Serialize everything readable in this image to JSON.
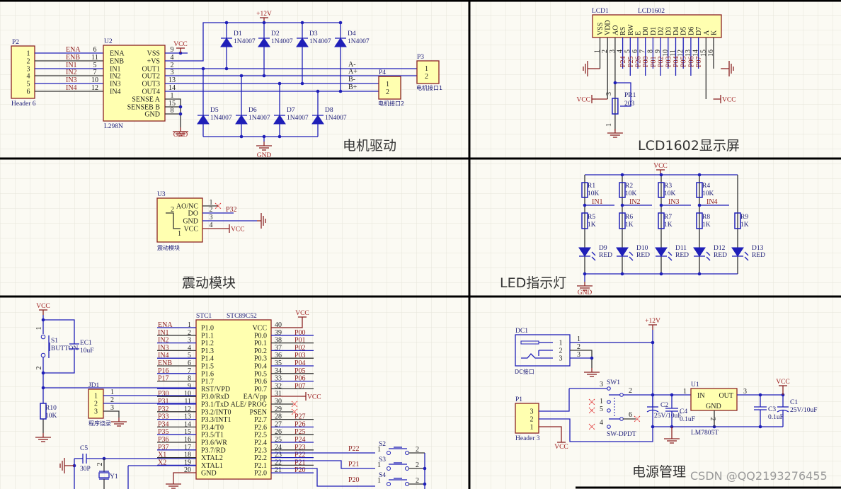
{
  "colors": {
    "wire": "#1f1fb8",
    "body_fill": "#ffffb0",
    "body_border": "#8b2323",
    "net_label": "#8b1c1c",
    "background": "#fbfaf3"
  },
  "sections": {
    "motor": "电机驱动",
    "lcd": "LCD1602显示屏",
    "vibration": "震动模块",
    "led": "LED指示灯",
    "power": "电源管理"
  },
  "watermark": "CSDN @QQ2193276455",
  "motor": {
    "p2": {
      "ref": "P2",
      "name": "Header 6",
      "pins": [
        "1",
        "2",
        "3",
        "4",
        "5",
        "6"
      ]
    },
    "u2": {
      "ref": "U2",
      "name": "L298N",
      "left_pins": [
        {
          "num": "6",
          "label": "ENA",
          "net": "ENA"
        },
        {
          "num": "11",
          "label": "ENB",
          "net": "ENB"
        },
        {
          "num": "5",
          "label": "IN1",
          "net": "IN1"
        },
        {
          "num": "7",
          "label": "IN2",
          "net": "IN2"
        },
        {
          "num": "10",
          "label": "IN3",
          "net": "IN3"
        },
        {
          "num": "12",
          "label": "IN4",
          "net": "IN4"
        }
      ],
      "right_pins": [
        {
          "num": "9",
          "label": "VSS"
        },
        {
          "num": "4",
          "label": "+VS"
        },
        {
          "num": "2",
          "label": "OUT1"
        },
        {
          "num": "3",
          "label": "OUT2"
        },
        {
          "num": "13",
          "label": "OUT3"
        },
        {
          "num": "14",
          "label": "OUT4"
        },
        {
          "num": "1",
          "label": "SENSE A"
        },
        {
          "num": "15",
          "label": "SENSEB B"
        },
        {
          "num": "8",
          "label": "GND"
        }
      ]
    },
    "vcc": "VCC",
    "gnd": "GND",
    "v12": "+12V",
    "gnd2": "GND",
    "diodes": [
      {
        "ref": "D1",
        "value": "1N4007"
      },
      {
        "ref": "D2",
        "value": "1N4007"
      },
      {
        "ref": "D3",
        "value": "1N4007"
      },
      {
        "ref": "D4",
        "value": "1N4007"
      },
      {
        "ref": "D5",
        "value": "1N4007"
      },
      {
        "ref": "D6",
        "value": "1N4007"
      },
      {
        "ref": "D7",
        "value": "1N4007"
      },
      {
        "ref": "D8",
        "value": "1N4007"
      }
    ],
    "outs": [
      "A-",
      "A+",
      "B-",
      "B+"
    ],
    "p3": {
      "ref": "P3",
      "name": "电机接口1",
      "pins": [
        "1",
        "2"
      ]
    },
    "p4": {
      "ref": "P4",
      "name": "电机接口2",
      "pins": [
        "1",
        "2"
      ]
    }
  },
  "lcd": {
    "ref": "LCD1",
    "name": "LCD1602",
    "pins": [
      {
        "num": "1",
        "label": "VSS"
      },
      {
        "num": "2",
        "label": "VDD"
      },
      {
        "num": "3",
        "label": "AO"
      },
      {
        "num": "4",
        "label": "RS"
      },
      {
        "num": "5",
        "label": "RW"
      },
      {
        "num": "6",
        "label": "E"
      },
      {
        "num": "7",
        "label": "D0"
      },
      {
        "num": "8",
        "label": "D1"
      },
      {
        "num": "9",
        "label": "D2"
      },
      {
        "num": "10",
        "label": "D3"
      },
      {
        "num": "11",
        "label": "D4"
      },
      {
        "num": "12",
        "label": "D5"
      },
      {
        "num": "13",
        "label": "D6"
      },
      {
        "num": "14",
        "label": "D7"
      },
      {
        "num": "15",
        "label": "A"
      },
      {
        "num": "16",
        "label": "K"
      }
    ],
    "nets": [
      "P24",
      "P25",
      "P26",
      "P00",
      "P01",
      "P02",
      "P03",
      "P04",
      "P05",
      "P06",
      "P07"
    ],
    "pot": {
      "ref": "PR1",
      "value": "203",
      "pin_top": "3",
      "pin_bottom": "1"
    },
    "vcc_left": "VCC",
    "vcc_right": "VCC"
  },
  "vibration": {
    "ref": "U3",
    "name": "震动模块",
    "pins": [
      {
        "num": "1",
        "label": "AO/NC"
      },
      {
        "num": "2",
        "label": "DO"
      },
      {
        "num": "3",
        "label": "GND"
      },
      {
        "num": "4",
        "label": "VCC"
      }
    ],
    "inner_pins": [
      "2",
      "1"
    ],
    "net": "P32",
    "vcc": "VCC"
  },
  "led": {
    "vcc": "VCC",
    "gnd": "GND",
    "pullups": [
      {
        "ref": "R1",
        "value": "10K",
        "net": "IN1"
      },
      {
        "ref": "R2",
        "value": "10K",
        "net": "IN2"
      },
      {
        "ref": "R3",
        "value": "10K",
        "net": "IN3"
      },
      {
        "ref": "R4",
        "value": "10K",
        "net": "IN4"
      }
    ],
    "resistors": [
      {
        "ref": "R5",
        "value": "1K"
      },
      {
        "ref": "R6",
        "value": "1K"
      },
      {
        "ref": "R7",
        "value": "1K"
      },
      {
        "ref": "R8",
        "value": "1K"
      },
      {
        "ref": "R9",
        "value": "1K"
      }
    ],
    "diodes": [
      {
        "ref": "D9",
        "value": "RED"
      },
      {
        "ref": "D10",
        "value": "RED"
      },
      {
        "ref": "D11",
        "value": "RED"
      },
      {
        "ref": "D12",
        "value": "RED"
      },
      {
        "ref": "D13",
        "value": "RED"
      }
    ]
  },
  "mcu": {
    "ref": "STC1",
    "name": "STC89C52",
    "left_pins": [
      {
        "num": "1",
        "label": "P1.0",
        "net": "ENA"
      },
      {
        "num": "2",
        "label": "P1.1",
        "net": "IN1"
      },
      {
        "num": "3",
        "label": "P1.2",
        "net": "IN2"
      },
      {
        "num": "4",
        "label": "P1.3",
        "net": "IN3"
      },
      {
        "num": "5",
        "label": "P1.4",
        "net": "IN4"
      },
      {
        "num": "6",
        "label": "P1.5",
        "net": "ENB"
      },
      {
        "num": "7",
        "label": "P1.6",
        "net": "P16"
      },
      {
        "num": "8",
        "label": "P1.7",
        "net": "P17"
      },
      {
        "num": "9",
        "label": "RST/VPD",
        "net": ""
      },
      {
        "num": "10",
        "label": "P3.0/RxD",
        "net": "P30"
      },
      {
        "num": "11",
        "label": "P3.1/TxD",
        "net": "P31"
      },
      {
        "num": "12",
        "label": "P3.2/INT0",
        "net": "P32"
      },
      {
        "num": "13",
        "label": "P3.3/INT1",
        "net": "P33"
      },
      {
        "num": "14",
        "label": "P3.4/T0",
        "net": "P34"
      },
      {
        "num": "15",
        "label": "P3.5/T1",
        "net": "P35"
      },
      {
        "num": "16",
        "label": "P3.6/WR",
        "net": "P36"
      },
      {
        "num": "17",
        "label": "P3.7/RD",
        "net": "P37"
      },
      {
        "num": "18",
        "label": "XTAL2",
        "net": "X1"
      },
      {
        "num": "19",
        "label": "XTAL1",
        "net": "X2"
      },
      {
        "num": "20",
        "label": "GND",
        "net": ""
      }
    ],
    "right_pins": [
      {
        "num": "40",
        "label": "VCC",
        "net": ""
      },
      {
        "num": "39",
        "label": "P0.0",
        "net": "P00"
      },
      {
        "num": "38",
        "label": "P0.1",
        "net": "P01"
      },
      {
        "num": "37",
        "label": "P0.2",
        "net": "P02"
      },
      {
        "num": "36",
        "label": "P0.3",
        "net": "P03"
      },
      {
        "num": "35",
        "label": "P0.4",
        "net": "P04"
      },
      {
        "num": "34",
        "label": "P0.5",
        "net": "P05"
      },
      {
        "num": "33",
        "label": "P0.6",
        "net": "P06"
      },
      {
        "num": "32",
        "label": "P0.7",
        "net": "P07"
      },
      {
        "num": "31",
        "label": "EA/Vpp",
        "net": ""
      },
      {
        "num": "30",
        "label": "ALE/ PROG",
        "net": ""
      },
      {
        "num": "29",
        "label": "PSEN",
        "net": ""
      },
      {
        "num": "28",
        "label": "P2.7",
        "net": "P27"
      },
      {
        "num": "27",
        "label": "P2.6",
        "net": "P26"
      },
      {
        "num": "26",
        "label": "P2.5",
        "net": "P25"
      },
      {
        "num": "25",
        "label": "P2.4",
        "net": "P24"
      },
      {
        "num": "24",
        "label": "P2.3",
        "net": "P23"
      },
      {
        "num": "23",
        "label": "P2.2",
        "net": "P22"
      },
      {
        "num": "22",
        "label": "P2.1",
        "net": "P21"
      },
      {
        "num": "21",
        "label": "P2.0",
        "net": "P20"
      }
    ],
    "vcc_top": "VCC",
    "vcc_ea": "VCC",
    "buttons": [
      {
        "ref": "S2",
        "net": "P22",
        "pin1": "1",
        "pin2": "2"
      },
      {
        "ref": "S3",
        "net": "P21",
        "pin1": "1",
        "pin2": "2"
      },
      {
        "ref": "S4",
        "net": "P20",
        "pin1": "1",
        "pin2": "2"
      }
    ],
    "reset": {
      "vcc": "VCC",
      "switch_ref": "S1",
      "switch_value": "BUTTON",
      "pin1": "1",
      "pin2": "2",
      "cap_ref": "EC1",
      "cap_value": "10uF",
      "res_ref": "R10",
      "res_value": "10K"
    },
    "jd1": {
      "ref": "JD1",
      "name": "程序烧录",
      "pins": [
        "1",
        "2",
        "3"
      ],
      "wire_pins": [
        "1",
        "2",
        "3"
      ]
    },
    "crystal": {
      "cap_ref": "C5",
      "cap_value": "30P",
      "xtal_ref": "Y1",
      "pin": "2"
    }
  },
  "power": {
    "dc1": {
      "ref": "DC1",
      "name": "DC接口",
      "pins": [
        "1",
        "2",
        "3"
      ],
      "wire_pins": [
        "1",
        "2",
        "3"
      ]
    },
    "v12": "+12V",
    "sw1": {
      "ref": "SW1",
      "name": "SW-DPDT",
      "pins": {
        "p3": "3",
        "p2": "2",
        "p1": "1",
        "p5": "5",
        "p6": "6",
        "p4": "4"
      }
    },
    "p1": {
      "ref": "P1",
      "name": "Header 3",
      "pins": [
        "3",
        "2",
        "1"
      ]
    },
    "vcc_p1": "VCC",
    "c2": {
      "ref": "C2",
      "value": "25V/10uF"
    },
    "c4": {
      "ref": "C4",
      "value": "0.1uF"
    },
    "u1": {
      "ref": "U1",
      "name": "LM7805T",
      "in": "IN",
      "out": "OUT",
      "gnd": "GND",
      "pin_in": "1",
      "pin_out": "3",
      "pin_gnd": "2"
    },
    "c3": {
      "ref": "C3",
      "value": "0.1uF"
    },
    "c1": {
      "ref": "C1",
      "value": "25V/10uF"
    },
    "vcc_out": "VCC"
  }
}
